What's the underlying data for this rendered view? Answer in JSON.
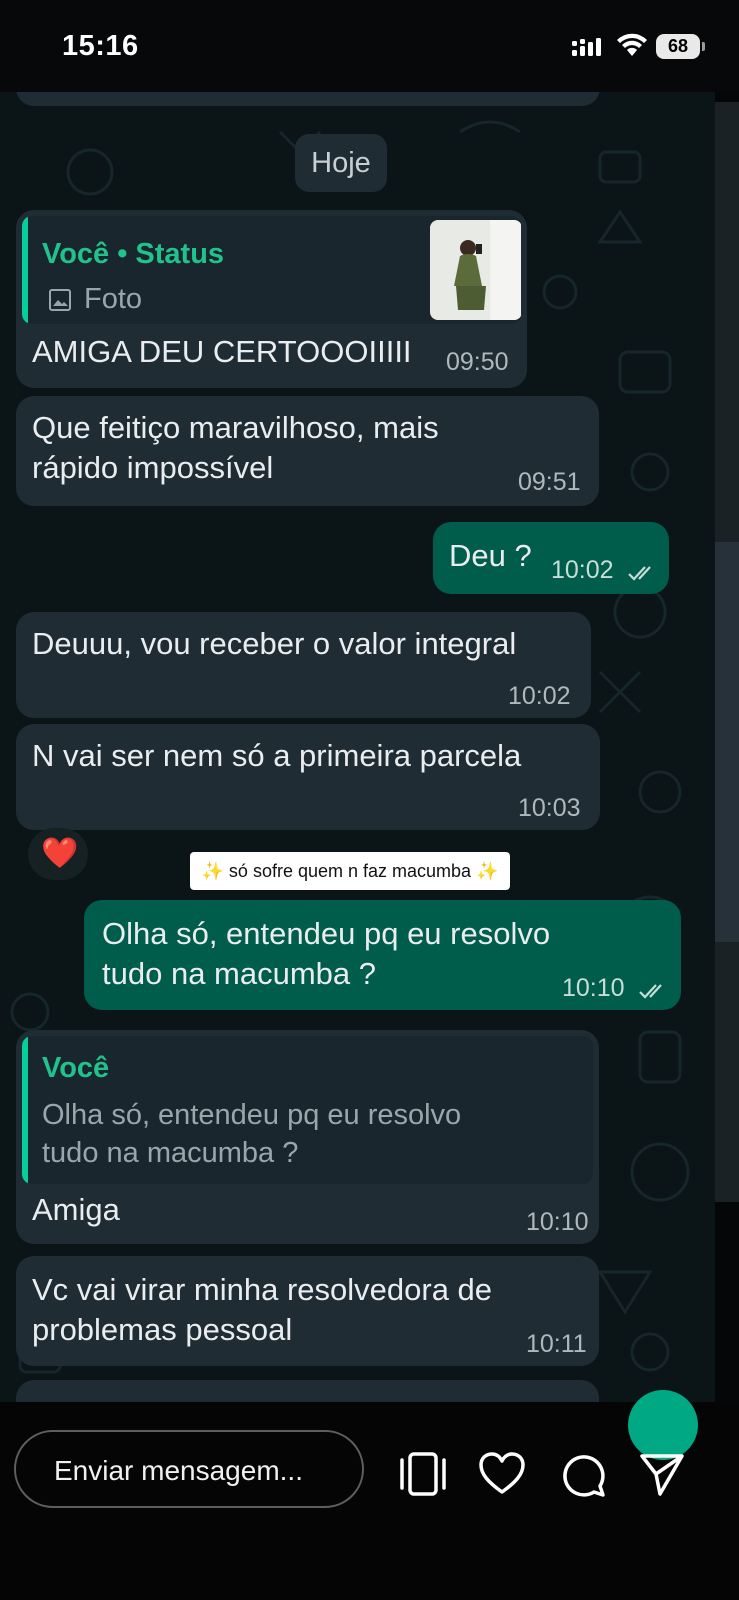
{
  "status_bar": {
    "time": "15:16",
    "battery": "68"
  },
  "chat": {
    "date_chip": "Hoje",
    "messages": [
      {
        "direction": "in",
        "quote_name": "Você • Status",
        "quote_text": "Foto",
        "text": "AMIGA DEU CERTOOOIIIII",
        "time": "09:50"
      },
      {
        "direction": "in",
        "lines": [
          "Que feitiço maravilhoso, mais",
          "rápido impossível"
        ],
        "time": "09:51"
      },
      {
        "direction": "out",
        "text": "Deu ?",
        "time": "10:02",
        "read": true
      },
      {
        "direction": "in",
        "text": "Deuuu, vou receber o valor integral",
        "time": "10:02"
      },
      {
        "direction": "in",
        "text": "N vai ser nem só a primeira parcela",
        "time": "10:03"
      },
      {
        "direction": "out",
        "lines": [
          "Olha só, entendeu pq eu resolvo",
          "tudo na macumba ?"
        ],
        "time": "10:10",
        "read": true
      },
      {
        "direction": "in",
        "quote_name": "Você",
        "quote_lines": [
          "Olha só, entendeu pq eu resolvo",
          "tudo na macumba ?"
        ],
        "text": "Amiga",
        "time": "10:10"
      },
      {
        "direction": "in",
        "lines": [
          "Vc vai virar minha resolvedora de",
          "problemas pessoal"
        ],
        "time": "10:11"
      }
    ],
    "reaction": "❤️",
    "sticker_text": "✨ só sofre quem n  faz macumba ✨"
  },
  "reply_bar": {
    "placeholder": "Enviar mensagem..."
  },
  "colors": {
    "outgoing_bubble": "#005c4b",
    "incoming_bubble": "#1f2c33",
    "quote_accent": "#06cf9c",
    "chat_background": "#0b1416"
  }
}
